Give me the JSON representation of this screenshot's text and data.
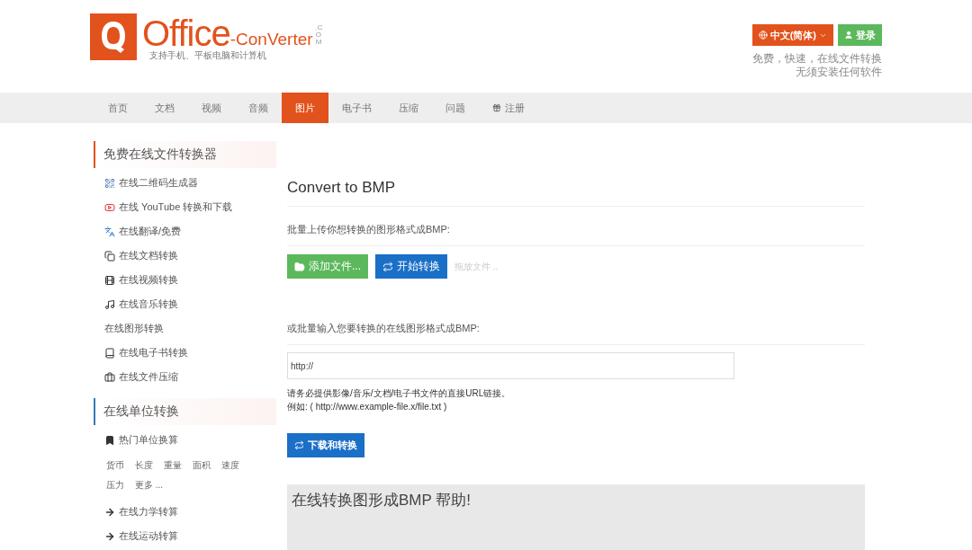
{
  "logo": {
    "brand": "Office",
    "suffix": "-ConVerter",
    "domain": ".COM",
    "tagline": "支持手机、平板电脑和计算机"
  },
  "header": {
    "language_button": "中文(简体)",
    "login_button": "登录",
    "slogan_lines": [
      "免费，快速，在线文件转换",
      "无须安装任何软件"
    ]
  },
  "nav": [
    {
      "label": "首页",
      "selected": false,
      "kind": "plain"
    },
    {
      "label": "文档",
      "selected": false,
      "kind": "plain"
    },
    {
      "label": "视频",
      "selected": false,
      "kind": "plain"
    },
    {
      "label": "音频",
      "selected": false,
      "kind": "plain"
    },
    {
      "label": "图片",
      "selected": true,
      "kind": "plain"
    },
    {
      "label": "电子书",
      "selected": false,
      "kind": "plain"
    },
    {
      "label": "压缩",
      "selected": false,
      "kind": "plain"
    },
    {
      "label": "问题",
      "selected": false,
      "kind": "plain"
    },
    {
      "label": "注册",
      "selected": false,
      "kind": "gift"
    }
  ],
  "sidebar": {
    "sections": [
      {
        "title": "免费在线文件转换器",
        "items": [
          {
            "label": "在线二维码生成器",
            "kind": "qr"
          },
          {
            "label": "在线 YouTube 转换和下载",
            "kind": "youtube"
          },
          {
            "label": "在线翻译/免费",
            "kind": "translate"
          },
          {
            "label": "在线文档转换",
            "kind": "document"
          },
          {
            "label": "在线视频转换",
            "kind": "video"
          },
          {
            "label": "在线音乐转换",
            "kind": "music"
          },
          {
            "label": "在线图形转换",
            "kind": "none"
          },
          {
            "label": "在线电子书转换",
            "kind": "book"
          },
          {
            "label": "在线文件压缩",
            "kind": "briefcase"
          }
        ]
      },
      {
        "title": "在线单位转换",
        "items": [
          {
            "label": "热门单位换算",
            "kind": "bookmark"
          },
          {
            "kind": "units",
            "units": [
              "货币",
              "长度",
              "重量",
              "面积",
              "速度",
              "压力",
              "更多 ..."
            ]
          },
          {
            "label": "在线力学转算",
            "kind": "arrow"
          },
          {
            "label": "在线运动转算",
            "kind": "arrow"
          }
        ]
      }
    ]
  },
  "main": {
    "title": "Convert to BMP",
    "upload_label": "批量上传你想转换的图形格式成BMP:",
    "add_files_button": "添加文件...",
    "start_button": "开始转换",
    "drop_hint": "拖放文件 ..",
    "url_label": "或批量输入您要转换的在线图形格式成BMP:",
    "url_field": {
      "value": "http://"
    },
    "url_help": [
      "请务必提供影像/音乐/文档/电子书文件的直接URL链接。",
      "例如: ( http://www.example-file.x/file.txt )"
    ],
    "download_button": "下载和转换",
    "help_title": "在线转换图形成BMP 帮助!"
  }
}
